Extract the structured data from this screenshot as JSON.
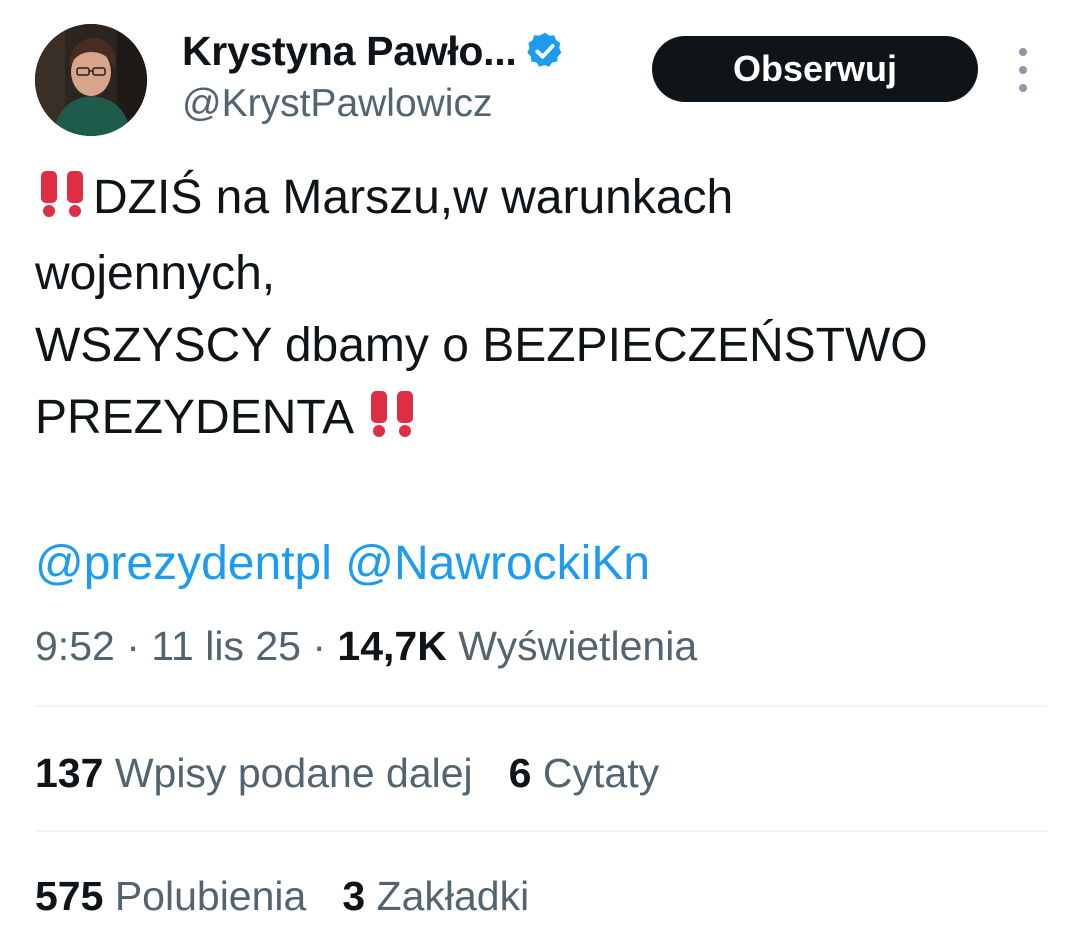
{
  "author": {
    "display_name": "Krystyna Pawło...",
    "handle": "@KrystPawlowicz",
    "verified": true,
    "avatar_icon": "avatar-photo"
  },
  "actions": {
    "follow_label": "Obserwuj",
    "more_icon": "more-vertical-icon"
  },
  "tweet": {
    "line1": "DZIŚ  na Marszu,w warunkach",
    "line2": "wojennych,",
    "line3": "WSZYSCY dbamy o BEZPIECZEŃSTWO",
    "line4": "PREZYDENTA",
    "emoji": "double-exclamation-icon",
    "mentions": [
      "@prezydentpl",
      "@NawrockiKn"
    ]
  },
  "meta": {
    "time": "9:52",
    "date": "11 lis 25",
    "separator": "·",
    "views_count": "14,7K",
    "views_label": "Wyświetlenia"
  },
  "stats": {
    "reposts_count": "137",
    "reposts_label": "Wpisy podane dalej",
    "quotes_count": "6",
    "quotes_label": "Cytaty",
    "likes_count": "575",
    "likes_label": "Polubienia",
    "bookmarks_count": "3",
    "bookmarks_label": "Zakładki"
  },
  "colors": {
    "accent_blue": "#1d9bf0",
    "text_primary": "#0f1419",
    "text_secondary": "#536471",
    "emoji_red": "#dd2e44",
    "follow_bg": "#0f1419"
  }
}
